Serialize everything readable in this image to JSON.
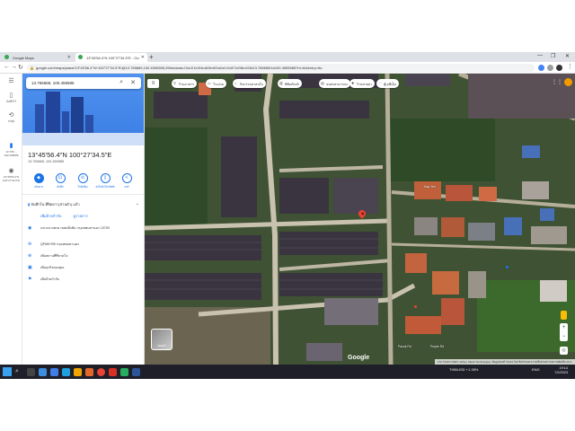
{
  "browser": {
    "tabs": [
      {
        "label": "Google Maps"
      },
      {
        "label": "13°45'56.4\"N 100°27'34.5\"E - Go"
      }
    ],
    "new_tab": "+",
    "url": "google.com/maps/place/13°45'56.4\"N+100°27'34.5\"E/@13.765669,100.4590585,298m/data=!3m1!1e3!4m6!3m5!1s0x0:0x0!7e2!8m2!3d13.765669!4d100.4595585?hl=th&entry=ttu",
    "window_controls": [
      "—",
      "❐",
      "✕"
    ]
  },
  "rail": {
    "items": [
      {
        "icon": "menu-icon",
        "glyph": "☰",
        "label": ""
      },
      {
        "icon": "bookmark-icon",
        "glyph": "🔖",
        "label": "บันทึกไว้"
      },
      {
        "icon": "history-icon",
        "glyph": "⟲",
        "label": "ล่าสุด"
      },
      {
        "icon": "pin-icon",
        "glyph": "▮",
        "label": "13.765..., 100.459585"
      },
      {
        "icon": "place-icon",
        "glyph": "◉",
        "label": "13°45'56.4\"N 100°27'34.5\"E"
      }
    ]
  },
  "panel": {
    "search_value": "13.765669, 100.459585",
    "title": "13°45'56.4\"N 100°27'34.5\"E",
    "subtitle": "13.765669, 100.459585",
    "actions": [
      {
        "label": "เส้นทาง",
        "glyph": "◆"
      },
      {
        "label": "บันทึก",
        "glyph": "⊡"
      },
      {
        "label": "ใกล้เคียง",
        "glyph": "⊙"
      },
      {
        "label": "ส่งไปยังโทรศัพท์",
        "glyph": "▯"
      },
      {
        "label": "แชร์",
        "glyph": "<"
      }
    ],
    "saved_text": "บันทึกใน ที่ติดดาว(ส่วนตัว) แล้ว",
    "links": [
      "เพิ่มป้ายกำกับ",
      "ดูรายการ"
    ],
    "info": [
      {
        "icon": "location-icon",
        "glyph": "◉",
        "text": "แขวงบางพรม เขตตลิ่งชัน กรุงเทพมหานคร 10700"
      },
      {
        "icon": "plus-code-icon",
        "glyph": "✣",
        "text": "QFM5+R8 กรุงเทพมหานคร"
      },
      {
        "icon": "add-place-icon",
        "glyph": "⊕",
        "text": "เพิ่มสถานที่ที่ขาดไป"
      },
      {
        "icon": "business-icon",
        "glyph": "▣",
        "text": "เพิ่มธุรกิจของคุณ"
      },
      {
        "icon": "label-icon",
        "glyph": "⚑",
        "text": "เพิ่มป้ายกำกับ"
      }
    ]
  },
  "map": {
    "chips": [
      {
        "icon": "restaurant-icon",
        "glyph": "🍴",
        "label": "ร้านอาหาร"
      },
      {
        "icon": "hotel-icon",
        "glyph": "🛏",
        "label": "โรงแรม"
      },
      {
        "icon": "attraction-icon",
        "glyph": "⌂",
        "label": "กิจกรรมน่าสนใจ"
      },
      {
        "icon": "museum-icon",
        "glyph": "▥",
        "label": "พิพิธภัณฑ์"
      },
      {
        "icon": "transit-icon",
        "glyph": "▤",
        "label": "ขนส่งสาธารณะ"
      },
      {
        "icon": "pharmacy-icon",
        "glyph": "✚",
        "label": "ร้านขายยา"
      },
      {
        "icon": "more-icon",
        "glyph": "•••",
        "label": "ตู้เอทีเอ็ม"
      }
    ],
    "layers_label": "เลเยอร์",
    "google_logo": "Google",
    "footer": "ภาพ ©2023 CNES / Airbus, Maxar Technologies, ข้อมูลแผนที่ ©2023  ไทย  ข้อกำหนด  ความเป็นส่วนตัว  ส่งความคิดเห็น  20 ม.",
    "street_labels": [
      "Pasuk Rd",
      "Purple Rd"
    ],
    "place_names": [
      "Jeap Yen"
    ],
    "colors": {
      "pin": "#ea4335",
      "chip_bg": "#ffffff",
      "accent": "#1a73e8"
    }
  },
  "taskbar": {
    "search_glyph": "⌕",
    "tray_text": "THB/USD  +1.35%",
    "language": "ENG",
    "time": "19:14",
    "date": "7/2/2023"
  }
}
